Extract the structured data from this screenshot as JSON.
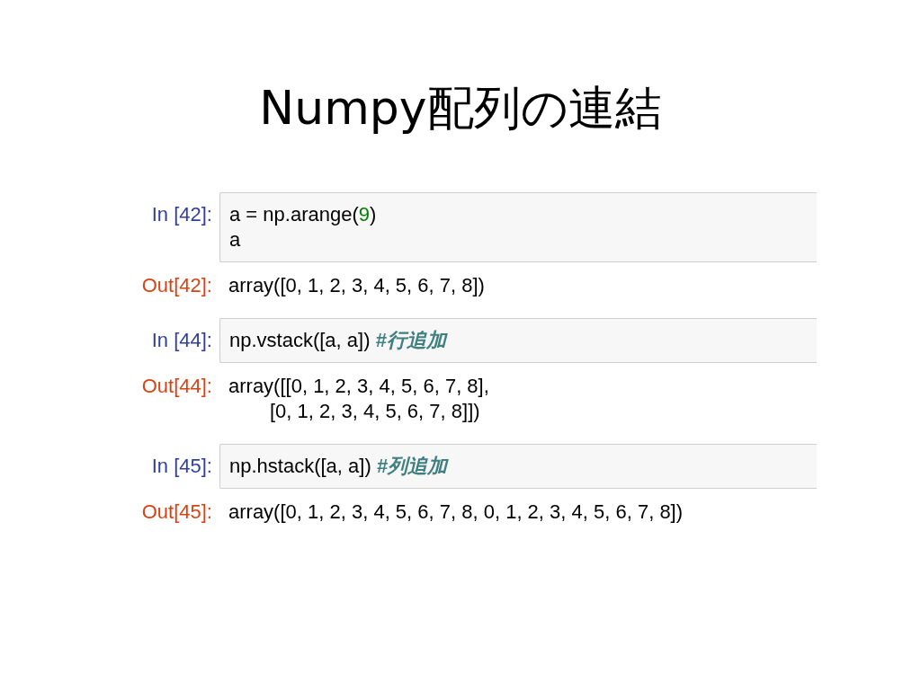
{
  "title": "Numpy配列の連結",
  "cells": [
    {
      "in_prompt": "In [42]:",
      "code": [
        [
          {
            "kind": "plain",
            "text": "a = np.arange("
          },
          {
            "kind": "number",
            "text": "9"
          },
          {
            "kind": "plain",
            "text": ")"
          }
        ],
        [
          {
            "kind": "plain",
            "text": "a"
          }
        ]
      ],
      "out_prompt": "Out[42]:",
      "output": [
        "array([0, 1, 2, 3, 4, 5, 6, 7, 8])"
      ]
    },
    {
      "in_prompt": "In [44]:",
      "code": [
        [
          {
            "kind": "plain",
            "text": "np.vstack([a, a])"
          },
          {
            "kind": "comment",
            "text": "#行追加"
          }
        ]
      ],
      "out_prompt": "Out[44]:",
      "output": [
        "array([[0, 1, 2, 3, 4, 5, 6, 7, 8],",
        "[0, 1, 2, 3, 4, 5, 6, 7, 8]])"
      ]
    },
    {
      "in_prompt": "In [45]:",
      "code": [
        [
          {
            "kind": "plain",
            "text": "np.hstack([a, a])"
          },
          {
            "kind": "comment",
            "text": "#列追加"
          }
        ]
      ],
      "out_prompt": "Out[45]:",
      "output": [
        "array([0, 1, 2, 3, 4, 5, 6, 7, 8, 0, 1, 2, 3, 4, 5, 6, 7, 8])"
      ]
    }
  ]
}
